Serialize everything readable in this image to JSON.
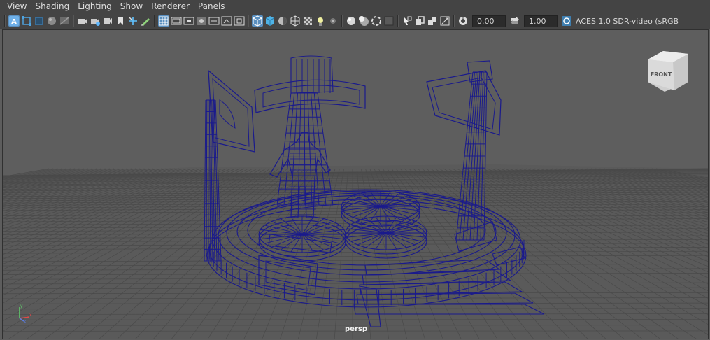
{
  "menu": {
    "items": [
      {
        "label": "View"
      },
      {
        "label": "Shading"
      },
      {
        "label": "Lighting"
      },
      {
        "label": "Show"
      },
      {
        "label": "Renderer"
      },
      {
        "label": "Panels"
      }
    ]
  },
  "toolbar": {
    "exposure_value": "0.00",
    "gamma_value": "1.00",
    "color_space_label": "ACES 1.0 SDR-video (sRGB"
  },
  "viewport": {
    "camera_label": "persp",
    "view_cube_face": "FRONT"
  },
  "colors": {
    "wireframe": "#1a1a8c",
    "grid": "#4a4a4a",
    "background": "#5e5e5e",
    "active_tool": "#5a8fbf"
  },
  "icons": [
    "select-tool-icon",
    "lasso-icon",
    "paint-select-icon",
    "soft-select-icon",
    "symmetry-icon",
    "camera-icon",
    "camera-attributes-icon",
    "bookmark-icon",
    "image-plane-icon",
    "2d-pan-icon",
    "grease-pencil-icon",
    "grid-icon",
    "film-gate-icon",
    "resolution-gate-icon",
    "gate-mask-icon",
    "field-chart-icon",
    "safe-action-icon",
    "safe-title-icon",
    "wireframe-icon",
    "smooth-shade-icon",
    "wireframe-on-shaded-icon",
    "textured-icon",
    "use-all-lights-icon",
    "shadows-icon",
    "screen-space-ao-icon",
    "motion-blur-icon",
    "anti-aliasing-icon",
    "depth-of-field-icon",
    "isolate-select-icon",
    "xray-icon",
    "xray-active-components-icon",
    "xray-joints-icon",
    "backface-culling-icon",
    "exposure-icon",
    "gamma-icon",
    "color-management-icon"
  ]
}
